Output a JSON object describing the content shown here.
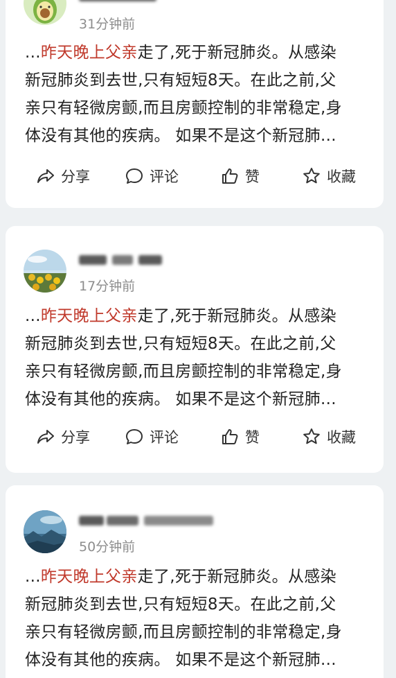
{
  "posts": [
    {
      "time": "31分钟前",
      "text_prefix": "...",
      "text_highlight": "昨天晚上父亲",
      "text_line1_rest": "走了,死于新冠肺炎。从感染",
      "text_line2": "新冠肺炎到去世,只有短短8天。在此之前,父",
      "text_line3": "亲只有轻微房颤,而且房颤控制的非常稳定,身",
      "text_line4": "体没有其他的疾病。 如果不是这个新冠肺...",
      "actions": {
        "share": "分享",
        "comment": "评论",
        "like": "赞",
        "favorite": "收藏"
      }
    },
    {
      "time": "17分钟前",
      "text_prefix": "...",
      "text_highlight": "昨天晚上父亲",
      "text_line1_rest": "走了,死于新冠肺炎。从感染",
      "text_line2": "新冠肺炎到去世,只有短短8天。在此之前,父",
      "text_line3": "亲只有轻微房颤,而且房颤控制的非常稳定,身",
      "text_line4": "体没有其他的疾病。 如果不是这个新冠肺...",
      "actions": {
        "share": "分享",
        "comment": "评论",
        "like": "赞",
        "favorite": "收藏"
      }
    },
    {
      "time": "50分钟前",
      "text_prefix": "...",
      "text_highlight": "昨天晚上父亲",
      "text_line1_rest": "走了,死于新冠肺炎。从感染",
      "text_line2": "新冠肺炎到去世,只有短短8天。在此之前,父",
      "text_line3": "亲只有轻微房颤,而且房颤控制的非常稳定,身",
      "text_line4": "体没有其他的疾病。 如果不是这个新冠肺..."
    }
  ],
  "colors": {
    "highlight": "#c0392b",
    "time": "#8d8d8d",
    "text": "#222222",
    "background": "#eef1f3",
    "card": "#ffffff"
  },
  "icons": [
    "share-icon",
    "comment-icon",
    "like-icon",
    "favorite-icon"
  ]
}
